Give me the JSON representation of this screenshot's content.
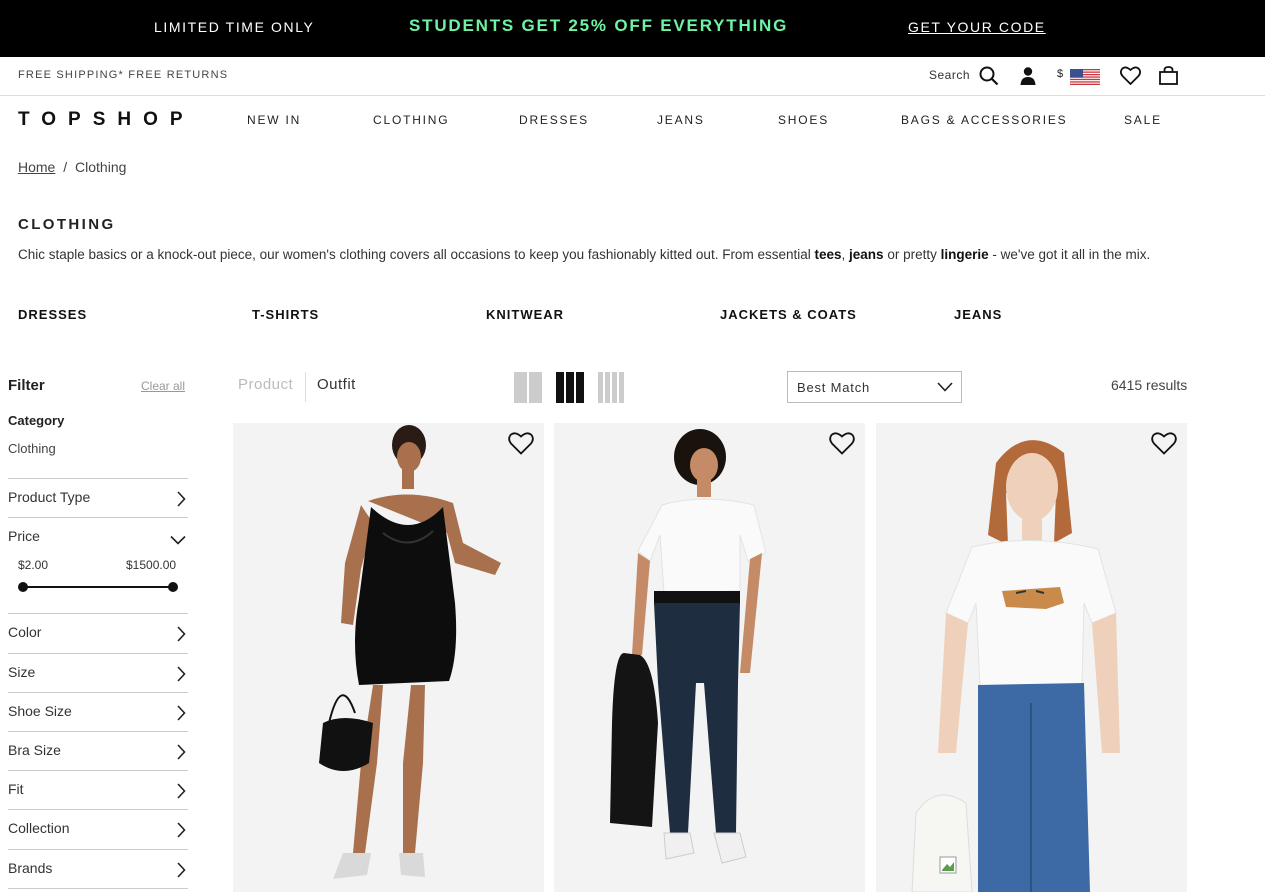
{
  "promo": {
    "left_text": "LIMITED TIME ONLY",
    "headline": "STUDENTS GET 25% OFF EVERYTHING",
    "cta": "GET YOUR CODE",
    "accent_color": "#6ef3a4"
  },
  "utility": {
    "shipping": "FREE SHIPPING* FREE RETURNS",
    "search_label": "Search",
    "currency": "$",
    "icons": [
      "search-icon",
      "account-icon",
      "us-flag-icon",
      "wishlist-heart-icon",
      "shopping-bag-icon"
    ]
  },
  "nav": {
    "logo": "TOPSHOP",
    "items": [
      "NEW IN",
      "CLOTHING",
      "DRESSES",
      "JEANS",
      "SHOES",
      "BAGS & ACCESSORIES",
      "SALE"
    ]
  },
  "breadcrumb": {
    "home": "Home",
    "separator": "/",
    "current": "Clothing"
  },
  "category": {
    "title": "CLOTHING",
    "intro_start": "Chic staple basics or a knock-out piece, our women's clothing covers all occasions to keep you fashionably kitted out. From essential ",
    "bold_1": "tees",
    "comma": ", ",
    "bold_2": "jeans",
    "or_pretty": " or pretty ",
    "bold_3": "lingerie",
    "intro_end": " - we've got it all in the mix."
  },
  "subcategories": [
    "DRESSES",
    "T-SHIRTS",
    "KNITWEAR",
    "JACKETS & COATS",
    "JEANS"
  ],
  "filters": {
    "heading": "Filter",
    "clear_all": "Clear all",
    "category_heading": "Category",
    "category_value": "Clothing",
    "rows": [
      "Product Type",
      "Price",
      "Color",
      "Size",
      "Shoe Size",
      "Bra Size",
      "Fit",
      "Collection",
      "Brands"
    ],
    "price_min": "$2.00",
    "price_max": "$1500.00"
  },
  "toolbar": {
    "product_label": "Product",
    "outfit_label": "Outfit",
    "view_options": [
      "2-column",
      "3-column",
      "4-column"
    ],
    "selected_view": "3-column",
    "sort_value": "Best Match",
    "results": "6415 results"
  },
  "products": [
    {
      "image": "black satin cowl-neck slip dress",
      "icon": "wishlist-heart-icon"
    },
    {
      "image": "white t-shirt with dark skinny jeans and leather jacket",
      "icon": "wishlist-heart-icon"
    },
    {
      "image": "white tiger-print t-shirt with blue mom jeans",
      "icon": "wishlist-heart-icon"
    }
  ]
}
